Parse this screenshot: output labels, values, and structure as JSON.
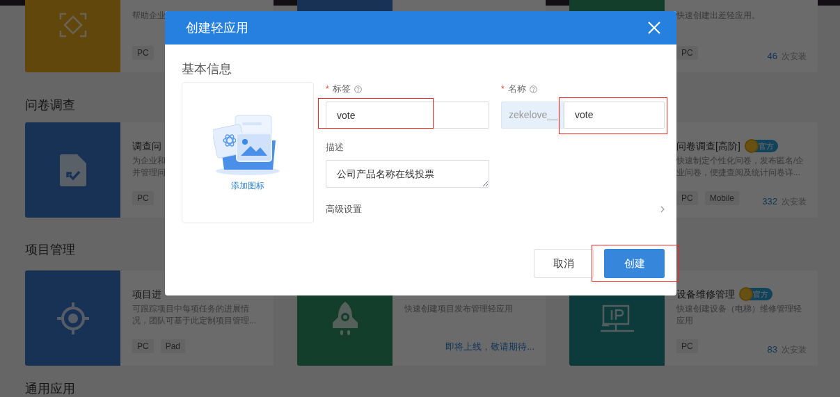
{
  "page": {
    "sections": [
      {
        "cards": [
          {
            "description_lines": [
              "帮助企业"
            ],
            "tags": [
              "PC"
            ]
          },
          {
            "description_lines": [
              "快速创建出差轻应用。"
            ],
            "tags": [
              "PC"
            ],
            "installs": {
              "count": "46",
              "unit": "次安装"
            }
          }
        ]
      },
      {
        "heading": "问卷调查",
        "cards": [
          {
            "title": "调查问",
            "description_lines": [
              "为企业和",
              "并管理问"
            ],
            "tags": [
              "PC"
            ]
          },
          {
            "title": "问卷调查[高阶]",
            "official": "官方",
            "description_lines": [
              "快速制定个性化问卷，发布匿名/企",
              "业问卷，便捷查阅及统计问卷详..."
            ],
            "tags": [
              "PC",
              "Mobile"
            ],
            "installs": {
              "count": "332",
              "unit": "次安装"
            }
          }
        ]
      },
      {
        "heading": "项目管理",
        "cards": [
          {
            "title": "项目进",
            "description_lines": [
              "可跟踪项目中每项任务的进展情",
              "况，团队可基于此定制项目管理..."
            ],
            "tags": [
              "PC",
              "Pad"
            ]
          },
          {
            "description_lines": [
              "快速创建项目发布管理轻应用"
            ],
            "note": "即将上线，敬请期待..."
          },
          {
            "title": "设备维修管理",
            "official": "官方",
            "description_lines": [
              "快速创建设备（电梯）维修管理轻",
              "应用"
            ],
            "tags": [
              "PC"
            ],
            "installs": {
              "count": "83",
              "unit": "次安装"
            }
          }
        ]
      },
      {
        "heading": "通用应用"
      }
    ]
  },
  "dialog": {
    "title": "创建轻应用",
    "section_title": "基本信息",
    "icon_picker": {
      "label": "添加图标"
    },
    "required_mark": "*",
    "fields": [
      {
        "kind": "text",
        "label": "标签",
        "required": true,
        "help": true,
        "value": "vote",
        "highlighted": true
      },
      {
        "kind": "prefixed",
        "label": "名称",
        "required": true,
        "help": true,
        "prefix": "zekelove__",
        "value": "vote",
        "highlighted": true
      },
      {
        "kind": "textarea",
        "label": "描述",
        "required": false,
        "help": false,
        "value": "公司产品名称在线投票"
      }
    ],
    "advanced": "高级设置",
    "buttons": [
      {
        "kind": "secondary",
        "label": "取消"
      },
      {
        "kind": "primary",
        "label": "创建",
        "highlighted": true
      }
    ]
  }
}
